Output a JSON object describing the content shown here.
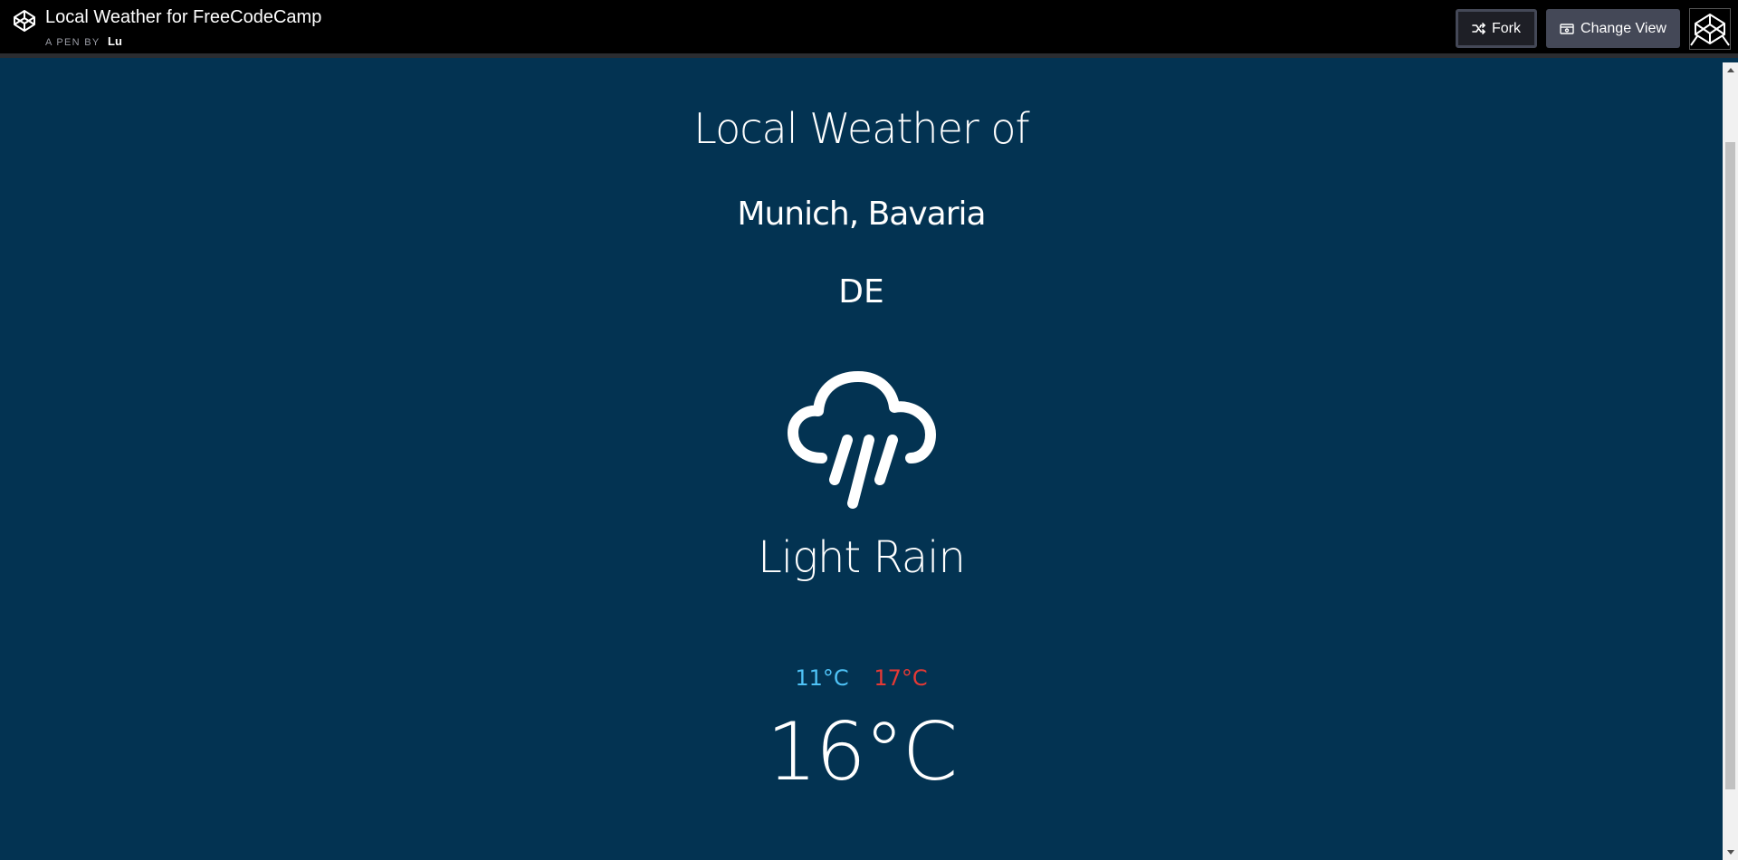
{
  "header": {
    "title": "Local Weather for FreeCodeCamp",
    "pen_by_label": "A PEN BY",
    "author": "Lu",
    "fork_label": "Fork",
    "change_view_label": "Change View"
  },
  "weather": {
    "heading": "Local Weather of",
    "city": "Munich, Bavaria",
    "country": "DE",
    "icon": "rain-cloud-icon",
    "condition": "Light Rain",
    "temp_min": "11°C",
    "temp_max": "17°C",
    "temp_current": "16°C"
  },
  "colors": {
    "background": "#033352",
    "topbar": "#000000",
    "temp_min": "#4fc3f7",
    "temp_max": "#e53935",
    "text": "#ffffff"
  }
}
